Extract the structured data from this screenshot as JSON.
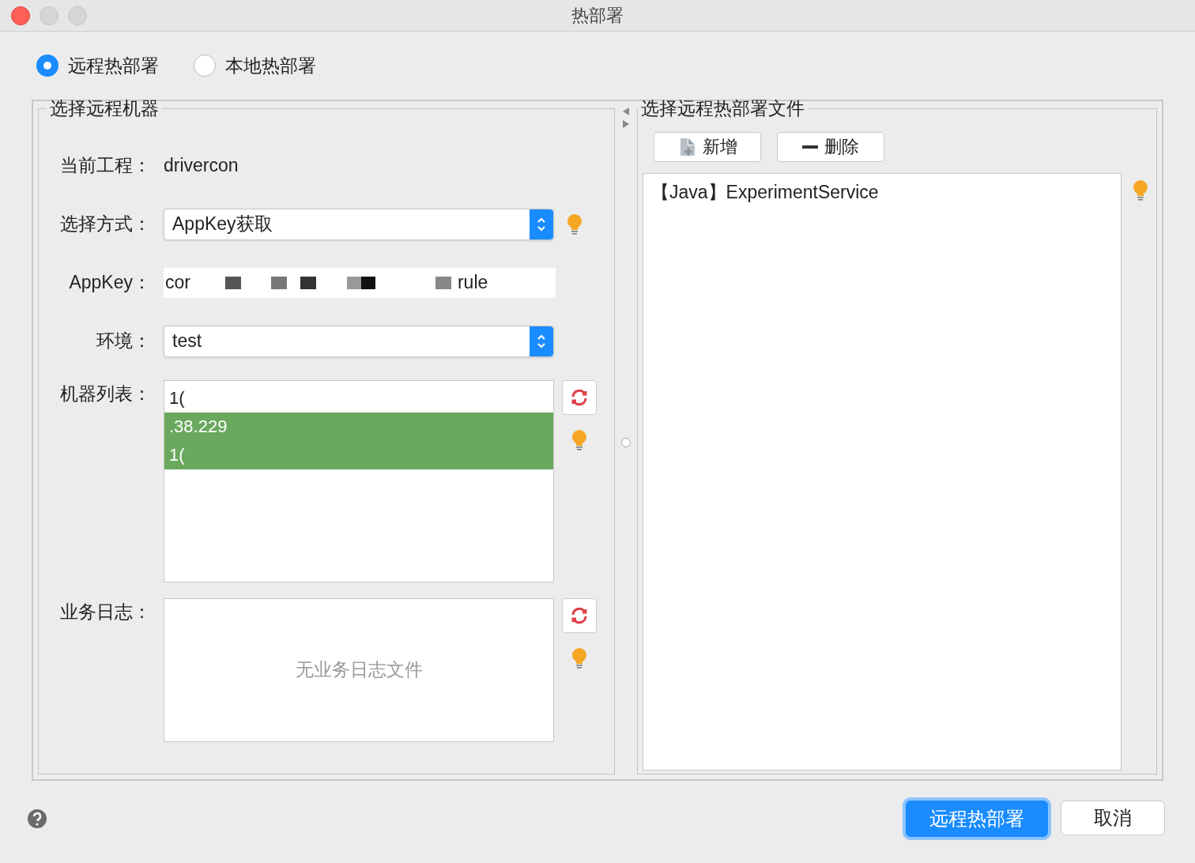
{
  "window": {
    "title": "热部署"
  },
  "modes": [
    {
      "label": "远程热部署",
      "selected": true
    },
    {
      "label": "本地热部署",
      "selected": false
    }
  ],
  "left_panel": {
    "title": "选择远程机器",
    "fields": [
      {
        "kind": "text",
        "label": "当前工程：",
        "value": "drivercon"
      },
      {
        "kind": "select",
        "label": "选择方式：",
        "value": "AppKey获取",
        "hint": true
      },
      {
        "kind": "masked",
        "label": "AppKey：",
        "value_start": "cor",
        "value_end": "rule"
      },
      {
        "kind": "select",
        "label": "环境：",
        "value": "test",
        "hint": false
      }
    ],
    "machines": {
      "label": "机器列表：",
      "rows": [
        {
          "text": "1(",
          "selected": false
        },
        {
          "text": ".38.229",
          "selected": true
        },
        {
          "text": "1(",
          "selected": true
        }
      ]
    },
    "log": {
      "label": "业务日志：",
      "placeholder": "无业务日志文件"
    }
  },
  "right_panel": {
    "title": "选择远程热部署文件",
    "buttons": [
      {
        "kind": "add",
        "label": "新增"
      },
      {
        "kind": "remove",
        "label": "删除"
      }
    ],
    "files": [
      {
        "text": "【Java】ExperimentService"
      }
    ]
  },
  "footer": {
    "buttons": [
      {
        "label": "远程热部署",
        "primary": true
      },
      {
        "label": "取消",
        "primary": false
      }
    ]
  }
}
